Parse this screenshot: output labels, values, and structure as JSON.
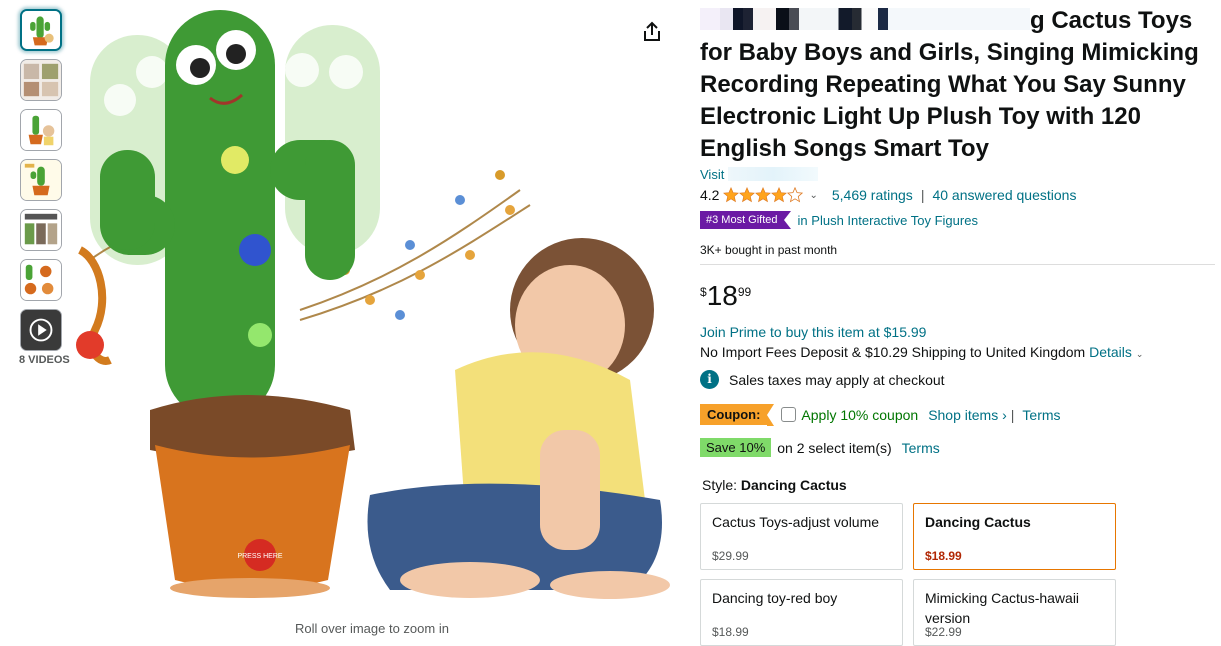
{
  "thumbnails": {
    "video_label": "8 VIDEOS"
  },
  "main_image": {
    "zoom_hint": "Roll over image to zoom in",
    "button_label": "PRESS HERE"
  },
  "product": {
    "title": "g Cactus Toys for Baby Boys and Girls, Singing Mimicking Recording Repeating What You Say Sunny Electronic Light Up Plush Toy with 120 English Songs Smart Toy",
    "store_prefix": "Visit",
    "rating_value": "4.2",
    "rating_stars": 4.2,
    "ratings_count": "5,469 ratings",
    "questions": "40 answered questions",
    "best_badge": "#3 Most Gifted",
    "best_category": "in Plush Interactive Toy Figures",
    "bought": "3K+ bought in past month"
  },
  "price": {
    "symbol": "$",
    "whole": "18",
    "fraction": "99"
  },
  "offers": {
    "prime": "Join Prime to buy this item at $15.99",
    "shipping": "No Import Fees Deposit & $10.29 Shipping to United Kingdom",
    "details_link": "Details",
    "tax": "Sales taxes may apply at checkout"
  },
  "coupon": {
    "tag": "Coupon:",
    "apply": "Apply 10% coupon",
    "shop_items": "Shop items ›",
    "divider": "|",
    "terms": "Terms"
  },
  "save": {
    "tag": "Save 10%",
    "text": "on 2 select item(s)",
    "terms": "Terms"
  },
  "style": {
    "label": "Style:",
    "selected": "Dancing Cactus",
    "options": [
      {
        "name": "Cactus Toys-adjust volume",
        "price": "$29.99"
      },
      {
        "name": "Dancing Cactus",
        "price": "$18.99"
      },
      {
        "name": "Dancing toy-red boy",
        "price": "$18.99"
      },
      {
        "name": "Mimicking Cactus-hawaii version",
        "price": "$22.99"
      }
    ]
  },
  "colors": {
    "link": "#007185",
    "badge": "#6b1aa4",
    "coupon": "#f7a12a",
    "save": "#7fda69",
    "selected_border": "#e77600",
    "price_selected": "#b12704"
  }
}
